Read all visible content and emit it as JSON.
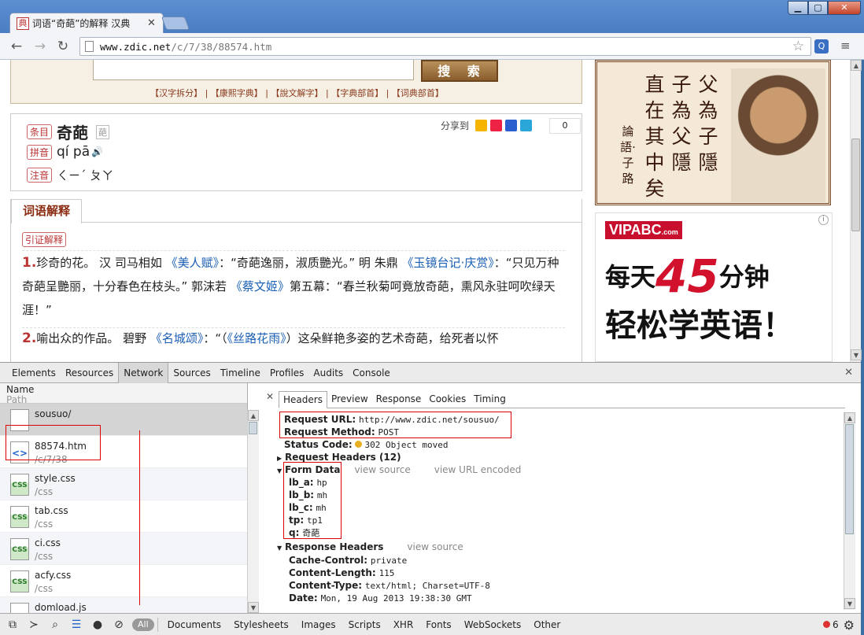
{
  "browser": {
    "tab_title": "词语“奇葩”的解释 汉典",
    "tab_favicon": "典",
    "url_host": "www.zdic.net",
    "url_path": "/c/7/38/88574.htm",
    "icons": [
      "back-icon",
      "forward-icon",
      "reload-icon",
      "page-icon",
      "bookmark-star-icon",
      "extension-icon",
      "menu-icon"
    ]
  },
  "page": {
    "search_button": "搜 索",
    "search_links": "【汉字拆分】 | 【康熙字典】 | 【說文解字】 | 【字典部首】 | 【词典部首】",
    "entry": {
      "label_word": "条目",
      "word": "奇葩",
      "label_pinyin": "拼音",
      "pinyin": "qí pā",
      "label_zhuyin": "注音",
      "zhuyin": "ㄑㄧˊ ㄆㄚ",
      "share_label": "分享到",
      "share_count": "0"
    },
    "def_tab": "词语解释",
    "def_label": "引证解释",
    "def1": {
      "num": "1.",
      "t1": "珍奇的花。 汉 司马相如 ",
      "l1": "《美人赋》",
      "t2": "：“奇葩逸丽，淑质艷光。” 明 朱鼎 ",
      "l2": "《玉镜台记·庆赏》",
      "t3": "：“只见万种奇葩呈艷丽，十分春色在枝头。” 郭沫若 ",
      "l3": "《蔡文姬》",
      "t4": "第五幕：“春兰秋菊呵竟放奇葩，熏风永驻呵吹绿天涯！”"
    },
    "def2": {
      "num": "2.",
      "t1": "喻出众的作品。 碧野 ",
      "l1": "《名城颂》",
      "t2": "：“（",
      "l2": "《丝路花雨》",
      "t3": "）这朵鲜艳多姿的艺术奇葩，给死者以怀"
    },
    "ad1": {
      "cols": [
        "父為子",
        "子為父",
        "直在其",
        "隱",
        "隱"
      ],
      "col1": "父為子隱",
      "col2": "子為父隱",
      "col3": "直在其中矣",
      "col4": "論語·子路"
    },
    "ad2": {
      "brand": "VIPABC",
      "brand_sub": ".com",
      "line1_a": "每天",
      "line1_num": "45",
      "line1_b": "分钟",
      "line2": "轻松学英语！"
    }
  },
  "devtools": {
    "tabs": [
      "Elements",
      "Resources",
      "Network",
      "Sources",
      "Timeline",
      "Profiles",
      "Audits",
      "Console"
    ],
    "active_tab": "Network",
    "list_header": "Name",
    "list_header_sub": "Path",
    "requests": [
      {
        "name": "sousuo/",
        "path": "",
        "type": "blank"
      },
      {
        "name": "88574.htm",
        "path": "/c/7/38",
        "type": "htm"
      },
      {
        "name": "style.css",
        "path": "/css",
        "type": "css"
      },
      {
        "name": "tab.css",
        "path": "/css",
        "type": "css"
      },
      {
        "name": "ci.css",
        "path": "/css",
        "type": "css"
      },
      {
        "name": "acfy.css",
        "path": "/css",
        "type": "css"
      },
      {
        "name": "domload.js",
        "path": "",
        "type": "js"
      }
    ],
    "detail_tabs": [
      "Headers",
      "Preview",
      "Response",
      "Cookies",
      "Timing"
    ],
    "active_detail_tab": "Headers",
    "request_url_label": "Request URL:",
    "request_url": "http://www.zdic.net/sousuo/",
    "request_method_label": "Request Method:",
    "request_method": "POST",
    "status_code_label": "Status Code:",
    "status_code": "302 Object moved",
    "request_headers": "Request Headers (12)",
    "form_data": "Form Data",
    "view_source": "view source",
    "view_url_encoded": "view URL encoded",
    "form": [
      {
        "k": "lb_a:",
        "v": "hp"
      },
      {
        "k": "lb_b:",
        "v": "mh"
      },
      {
        "k": "lb_c:",
        "v": "mh"
      },
      {
        "k": "tp:",
        "v": "tp1"
      },
      {
        "k": "q:",
        "v": "奇葩"
      }
    ],
    "response_headers": "Response Headers",
    "response": [
      {
        "k": "Cache-Control:",
        "v": "private"
      },
      {
        "k": "Content-Length:",
        "v": "115"
      },
      {
        "k": "Content-Type:",
        "v": "text/html; Charset=UTF-8"
      },
      {
        "k": "Date:",
        "v": "Mon, 19 Aug 2013 19:38:30 GMT"
      }
    ],
    "filters": [
      "All",
      "Documents",
      "Stylesheets",
      "Images",
      "Scripts",
      "XHR",
      "Fonts",
      "WebSockets",
      "Other"
    ],
    "error_count": "6"
  }
}
